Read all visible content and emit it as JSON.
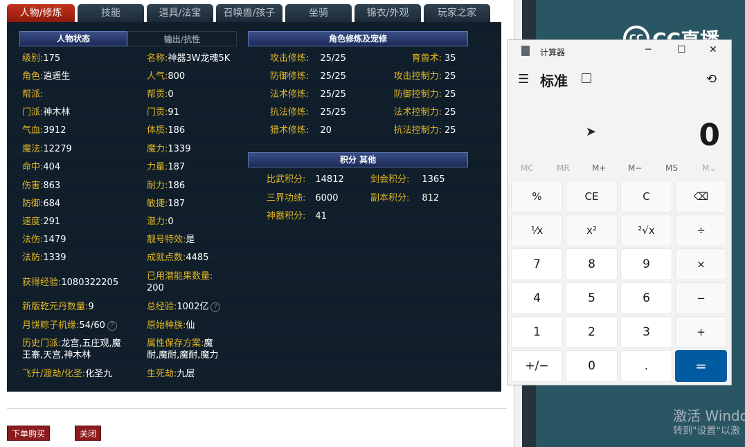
{
  "tabs": [
    "人物/修炼",
    "技能",
    "道具/法宝",
    "召唤兽/孩子",
    "坐骑",
    "锦衣/外观",
    "玩家之家"
  ],
  "status": {
    "title": "人物状态",
    "tab2": "输出/抗性",
    "left": [
      {
        "label": "级别:",
        "value": "175"
      },
      {
        "label": "角色:",
        "value": "逍遥生"
      },
      {
        "label": "帮派:",
        "value": ""
      },
      {
        "label": "门派:",
        "value": "神木林"
      },
      {
        "label": "气血:",
        "value": "3912"
      },
      {
        "label": "魔法:",
        "value": "12279"
      },
      {
        "label": "命中:",
        "value": "404"
      },
      {
        "label": "伤害:",
        "value": "863"
      },
      {
        "label": "防御:",
        "value": "684"
      },
      {
        "label": "速度:",
        "value": "291"
      },
      {
        "label": "法伤:",
        "value": "1479"
      },
      {
        "label": "法防:",
        "value": "1339"
      }
    ],
    "right": [
      {
        "label": "名称:",
        "value": "神器3W龙魂5K"
      },
      {
        "label": "人气:",
        "value": "800"
      },
      {
        "label": "帮贡:",
        "value": "0"
      },
      {
        "label": "门贡:",
        "value": "91"
      },
      {
        "label": "体质:",
        "value": "186"
      },
      {
        "label": "魔力:",
        "value": "1339"
      },
      {
        "label": "力量:",
        "value": "187"
      },
      {
        "label": "耐力:",
        "value": "186"
      },
      {
        "label": "敏捷:",
        "value": "187"
      },
      {
        "label": "潜力:",
        "value": "0"
      },
      {
        "label": "靓号特效:",
        "value": "是"
      },
      {
        "label": "成就点数:",
        "value": "4485"
      }
    ],
    "exp": {
      "label": "获得经验:",
      "value": "1080322205"
    },
    "fruit": {
      "label1": "已用潜能果数量:",
      "value": "200"
    },
    "xinban": {
      "label": "新版乾元丹数量:",
      "value": "9"
    },
    "total_exp": {
      "label": "总经验:",
      "value": "1002亿"
    },
    "zongzi": {
      "label": "月饼粽子机缘:",
      "value": "54/60"
    },
    "race": {
      "label": "原始种族:",
      "value": "仙"
    },
    "history": {
      "label": "历史门派:",
      "line1": "龙宫,五庄观,魔",
      "line2": "王寨,天宫,神木林"
    },
    "attrsave": {
      "label": "属性保存方案:",
      "line1": "魔",
      "line2": "耐,魔耐,魔耐,魔力"
    },
    "feisheng": {
      "label": "飞升/渡劫/化圣:",
      "value": "化圣九"
    },
    "shengsi": {
      "label": "生死劫:",
      "value": "九层"
    }
  },
  "cultivation": {
    "title": "角色修炼及宠修",
    "left": [
      {
        "label": "攻击修炼:",
        "value": "25/25"
      },
      {
        "label": "防御修炼:",
        "value": "25/25"
      },
      {
        "label": "法术修炼:",
        "value": "25/25"
      },
      {
        "label": "抗法修炼:",
        "value": "25/25"
      },
      {
        "label": "猎术修炼:",
        "value": "20"
      }
    ],
    "right": [
      {
        "label": "育兽术:",
        "value": "35"
      },
      {
        "label": "攻击控制力:",
        "value": "25"
      },
      {
        "label": "防御控制力:",
        "value": "25"
      },
      {
        "label": "法术控制力:",
        "value": "25"
      },
      {
        "label": "抗法控制力:",
        "value": "25"
      }
    ]
  },
  "points": {
    "title": "积分 其他",
    "rows": [
      {
        "l1": "比武积分:",
        "v1": "14812",
        "l2": "剑会积分:",
        "v2": "1365"
      },
      {
        "l1": "三界功绩:",
        "v1": "6000",
        "l2": "副本积分:",
        "v2": "812"
      },
      {
        "l1": "神器积分:",
        "v1": "41",
        "l2": "",
        "v2": ""
      }
    ]
  },
  "buttons": {
    "buy": "下单购买",
    "close": "关闭"
  },
  "calc": {
    "title": "计算器",
    "mode": "标准",
    "display": "0",
    "memory": [
      "MC",
      "MR",
      "M+",
      "M−",
      "MS",
      "M⌄"
    ],
    "keys": [
      "%",
      "CE",
      "C",
      "⌫",
      "¹⁄x",
      "x²",
      "²√x",
      "÷",
      "7",
      "8",
      "9",
      "×",
      "4",
      "5",
      "6",
      "−",
      "1",
      "2",
      "3",
      "+",
      "+/−",
      "0",
      ".",
      "="
    ]
  },
  "overlay": {
    "brand": "CC直播",
    "brand_icon": "CC",
    "activate_line1": "激活 Windo",
    "activate_line2": "转到\"设置\"以激"
  }
}
